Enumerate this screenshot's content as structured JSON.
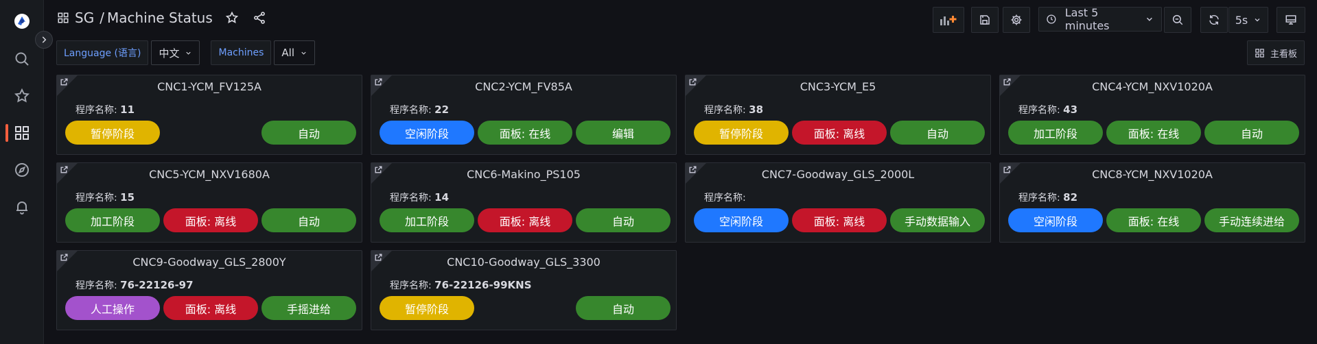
{
  "breadcrumb": {
    "folder": "SG",
    "separator": "/",
    "title": "Machine Status"
  },
  "toolbar": {
    "time_range": "Last 5 minutes",
    "refresh": "5s"
  },
  "variables": [
    {
      "label": "Language (语言)",
      "value": "中文"
    },
    {
      "label": "Machines",
      "value": "All"
    }
  ],
  "main_board_label": "主看板",
  "program_label": "程序名称:",
  "colors": {
    "yellow": "#e0b400",
    "blue": "#1f78ff",
    "green": "#37872d",
    "red": "#c4162a",
    "purple": "#a352cc"
  },
  "panels": [
    {
      "title": "CNC1-YCM_FV125A",
      "program": "11",
      "pills": [
        {
          "text": "暂停阶段",
          "color": "yellow"
        },
        {
          "text": "",
          "color": ""
        },
        {
          "text": "自动",
          "color": "green"
        }
      ]
    },
    {
      "title": "CNC2-YCM_FV85A",
      "program": "22",
      "pills": [
        {
          "text": "空闲阶段",
          "color": "blue"
        },
        {
          "text": "面板: 在线",
          "color": "green"
        },
        {
          "text": "编辑",
          "color": "green"
        }
      ]
    },
    {
      "title": "CNC3-YCM_E5",
      "program": "38",
      "pills": [
        {
          "text": "暂停阶段",
          "color": "yellow"
        },
        {
          "text": "面板: 离线",
          "color": "red"
        },
        {
          "text": "自动",
          "color": "green"
        }
      ]
    },
    {
      "title": "CNC4-YCM_NXV1020A",
      "program": "43",
      "pills": [
        {
          "text": "加工阶段",
          "color": "green"
        },
        {
          "text": "面板: 在线",
          "color": "green"
        },
        {
          "text": "自动",
          "color": "green"
        }
      ]
    },
    {
      "title": "CNC5-YCM_NXV1680A",
      "program": "15",
      "pills": [
        {
          "text": "加工阶段",
          "color": "green"
        },
        {
          "text": "面板: 离线",
          "color": "red"
        },
        {
          "text": "自动",
          "color": "green"
        }
      ]
    },
    {
      "title": "CNC6-Makino_PS105",
      "program": "14",
      "pills": [
        {
          "text": "加工阶段",
          "color": "green"
        },
        {
          "text": "面板: 离线",
          "color": "red"
        },
        {
          "text": "自动",
          "color": "green"
        }
      ]
    },
    {
      "title": "CNC7-Goodway_GLS_2000L",
      "program": "",
      "pills": [
        {
          "text": "空闲阶段",
          "color": "blue"
        },
        {
          "text": "面板: 离线",
          "color": "red"
        },
        {
          "text": "手动数据输入",
          "color": "green"
        }
      ]
    },
    {
      "title": "CNC8-YCM_NXV1020A",
      "program": "82",
      "pills": [
        {
          "text": "空闲阶段",
          "color": "blue"
        },
        {
          "text": "面板: 在线",
          "color": "green"
        },
        {
          "text": "手动连续进给",
          "color": "green"
        }
      ]
    },
    {
      "title": "CNC9-Goodway_GLS_2800Y",
      "program": "76-22126-97",
      "pills": [
        {
          "text": "人工操作",
          "color": "purple"
        },
        {
          "text": "面板: 离线",
          "color": "red"
        },
        {
          "text": "手摇进给",
          "color": "green"
        }
      ]
    },
    {
      "title": "CNC10-Goodway_GLS_3300",
      "program": "76-22126-99KNS",
      "pills": [
        {
          "text": "暂停阶段",
          "color": "yellow"
        },
        {
          "text": "",
          "color": ""
        },
        {
          "text": "自动",
          "color": "green"
        }
      ]
    }
  ]
}
